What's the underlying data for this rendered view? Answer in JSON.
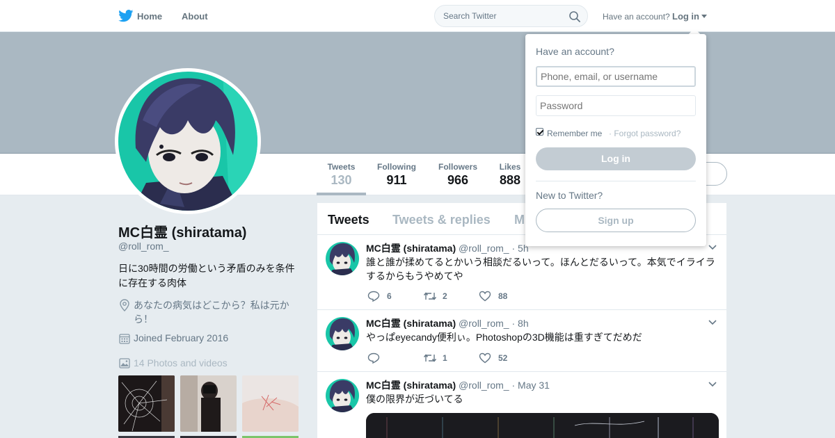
{
  "nav": {
    "home_label": "Home",
    "about_label": "About",
    "search_placeholder": "Search Twitter",
    "have_account": "Have an account?",
    "login_label": "Log in"
  },
  "profile": {
    "name": "MC白霊 (shiratama)",
    "handle": "@roll_rom_",
    "bio": "日に30時間の労働という矛盾のみを条件に存在する肉体",
    "location": "あなたの病気はどこから？私は元から！",
    "joined": "Joined February 2016",
    "photos_link": "14 Photos and videos"
  },
  "stats": [
    {
      "label": "Tweets",
      "value": "130",
      "active": true
    },
    {
      "label": "Following",
      "value": "911",
      "active": false
    },
    {
      "label": "Followers",
      "value": "966",
      "active": false
    },
    {
      "label": "Likes",
      "value": "888",
      "active": false
    }
  ],
  "timeline": {
    "tabs": [
      "Tweets",
      "Tweets & replies",
      "M"
    ],
    "active_tab": "Tweets",
    "tweets": [
      {
        "name": "MC白霊 (shiratama)",
        "handle": "@roll_rom_",
        "time": "· 5h",
        "text": "誰と誰が揉めてるとかいう相談だるいって。ほんとだるいって。本気でイライラするからもうやめてや",
        "replies": "",
        "reply_count": "6",
        "retweets": "2",
        "likes": "88"
      },
      {
        "name": "MC白霊 (shiratama)",
        "handle": "@roll_rom_",
        "time": "· 8h",
        "text": "やっぱeyecandy便利ぃ。Photoshopの3D機能は重すぎてだめだ",
        "reply_count": "",
        "retweets": "1",
        "likes": "52"
      },
      {
        "name": "MC白霊 (shiratama)",
        "handle": "@roll_rom_",
        "time": "· May 31",
        "text": "僕の限界が近づいてる"
      }
    ]
  },
  "login_dropdown": {
    "title": "Have an account?",
    "username_placeholder": "Phone, email, or username",
    "password_placeholder": "Password",
    "remember_label": "Remember me",
    "forgot_label": "· Forgot password?",
    "login_button": "Log in",
    "new_to_twitter": "New to Twitter?",
    "signup_button": "Sign up"
  },
  "icons": {
    "logo": "twitter-bird-icon",
    "search": "search-icon",
    "location": "location-pin-icon",
    "calendar": "calendar-icon",
    "photo": "photo-icon",
    "reply": "reply-icon",
    "retweet": "retweet-icon",
    "like": "heart-icon",
    "chevron": "chevron-down-icon"
  },
  "colors": {
    "brand": "#1da1f2",
    "banner": "#aab8c2",
    "text_secondary": "#657786",
    "background": "#e6ecf0"
  }
}
